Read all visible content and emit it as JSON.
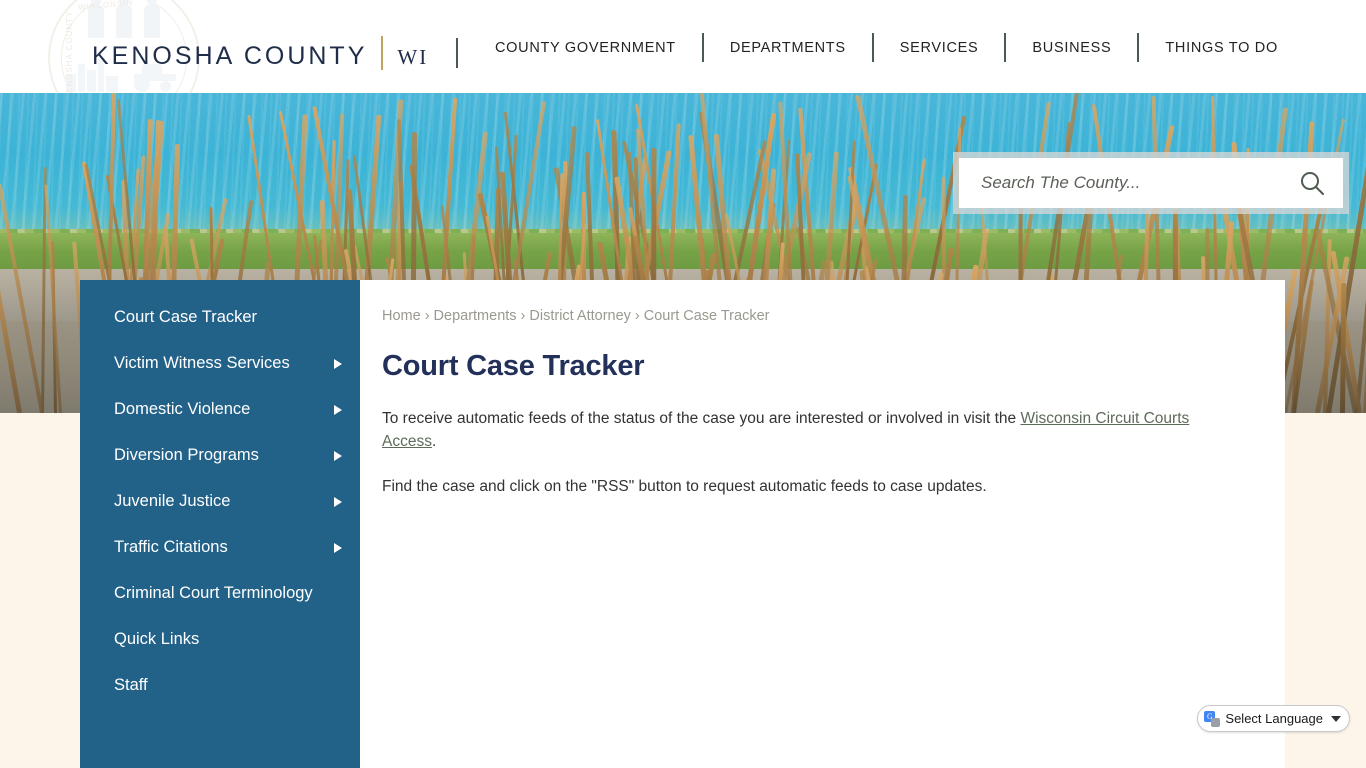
{
  "header": {
    "logo_main": "KENOSHA COUNTY",
    "logo_state": "WI",
    "seal_text_top": "KENOSHA COUNTY",
    "seal_text_bottom": "WISCONSIN",
    "nav": [
      {
        "label": "COUNTY GOVERNMENT"
      },
      {
        "label": "DEPARTMENTS"
      },
      {
        "label": "SERVICES"
      },
      {
        "label": "BUSINESS"
      },
      {
        "label": "THINGS TO DO"
      }
    ]
  },
  "search": {
    "placeholder": "Search The County...",
    "value": "",
    "icon": "search-icon"
  },
  "sidebar": {
    "background_color": "#226188",
    "items": [
      {
        "label": "Court Case Tracker",
        "has_submenu": false
      },
      {
        "label": "Victim Witness Services",
        "has_submenu": true
      },
      {
        "label": "Domestic Violence",
        "has_submenu": true
      },
      {
        "label": "Diversion Programs",
        "has_submenu": true
      },
      {
        "label": "Juvenile Justice",
        "has_submenu": true
      },
      {
        "label": "Traffic Citations",
        "has_submenu": true
      },
      {
        "label": "Criminal Court Terminology",
        "has_submenu": false
      },
      {
        "label": "Quick Links",
        "has_submenu": false
      },
      {
        "label": "Staff",
        "has_submenu": false
      }
    ]
  },
  "breadcrumb": {
    "items": [
      {
        "label": "Home"
      },
      {
        "label": "Departments"
      },
      {
        "label": "District Attorney"
      },
      {
        "label": "Court Case Tracker"
      }
    ],
    "separator": "›"
  },
  "main": {
    "title": "Court Case Tracker",
    "paragraph1_before_link": "To receive automatic feeds of the status of the case you are interested or involved in visit the ",
    "paragraph1_link": "Wisconsin Circuit Courts Access",
    "paragraph1_after_link": ".",
    "paragraph2": "Find the case and click on the \"RSS\" button to request automatic feeds to case updates.",
    "title_color": "#22305a",
    "link_color": "#5e6b5a"
  },
  "translate": {
    "label": "Select Language",
    "icon": "google-translate-icon",
    "caret": "chevron-down-icon"
  }
}
